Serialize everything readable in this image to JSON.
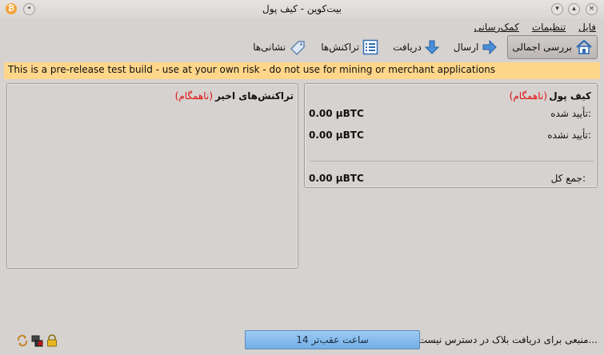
{
  "window": {
    "title": "بیت‌کوین - کیف پول"
  },
  "menu": {
    "items": [
      "فایل",
      "تنظیمات",
      "کمک‌رسانی"
    ]
  },
  "toolbar": {
    "overview": "بررسی اجمالی",
    "send": "ارسال",
    "receive": "دریافت",
    "transactions": "تراکنش‌ها",
    "addresses": "نشانی‌ها"
  },
  "banner": {
    "text": "This is a pre-release test build - use at your own risk - do not use for mining or merchant applications",
    "color": "#ffd68a"
  },
  "wallet": {
    "title": "کیف پول",
    "status": "(ناهمگام)",
    "confirmed_label": "تأیید شده:",
    "confirmed_value": "0.00 µBTC",
    "unconfirmed_label": "تأیید نشده:",
    "unconfirmed_value": "0.00 µBTC",
    "total_label": "جمع کل:",
    "total_value": "0.00 µBTC"
  },
  "recent": {
    "title": "تراکنش‌های اخیر",
    "status": "(ناهمگام)"
  },
  "statusbar": {
    "sync_text": "منبعی برای دریافت بلاک در دسترس نیست...",
    "progress_text": "14 ساعت عقب‌تر"
  },
  "colors": {
    "background": "#d6d2d0",
    "out_of_sync": "#e01010",
    "progress": "#73aee6"
  }
}
